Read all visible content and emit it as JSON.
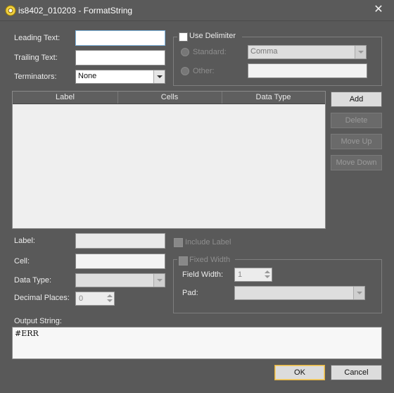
{
  "window": {
    "title": "is8402_010203 - FormatString",
    "close_glyph": "✕"
  },
  "leading_text": {
    "label": "Leading Text:",
    "value": ""
  },
  "trailing_text": {
    "label": "Trailing Text:",
    "value": ""
  },
  "terminators": {
    "label": "Terminators:",
    "value": "None"
  },
  "delimiter": {
    "label": "Use Delimiter",
    "checked": false,
    "standard_label": "Standard:",
    "standard_value": "Comma",
    "other_label": "Other:",
    "other_value": ""
  },
  "table": {
    "columns": [
      "Label",
      "Cells",
      "Data Type"
    ],
    "rows": []
  },
  "buttons": {
    "add": "Add",
    "delete": "Delete",
    "move_up": "Move Up",
    "move_down": "Move Down",
    "ok": "OK",
    "cancel": "Cancel"
  },
  "item": {
    "label_label": "Label:",
    "label_value": "",
    "cell_label": "Cell:",
    "cell_value": "",
    "data_type_label": "Data Type:",
    "data_type_value": "",
    "decimal_places_label": "Decimal Places:",
    "decimal_places_value": "0",
    "include_label": "Include Label",
    "fixed_width": "Fixed Width",
    "field_width_label": "Field Width:",
    "field_width_value": "1",
    "pad_label": "Pad:",
    "pad_value": ""
  },
  "output": {
    "label": "Output String:",
    "value": "#ERR"
  }
}
